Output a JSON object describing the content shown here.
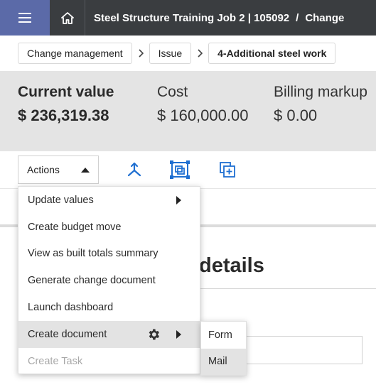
{
  "header": {
    "title_job": "Steel Structure Training Job 2 | 105092",
    "title_sep": "/",
    "title_section": "Change"
  },
  "breadcrumb": {
    "items": [
      {
        "label": "Change management"
      },
      {
        "label": "Issue"
      },
      {
        "label": "4-Additional steel work"
      }
    ]
  },
  "summary": {
    "current_label": "Current value",
    "current_value": "$ 236,319.38",
    "cost_label": "Cost",
    "cost_value": "$ 160,000.00",
    "billing_label": "Billing markup",
    "billing_value": "$ 0.00"
  },
  "toolbar": {
    "actions_label": "Actions"
  },
  "actions_menu": {
    "items": [
      {
        "label": "Update values"
      },
      {
        "label": "Create budget move"
      },
      {
        "label": "View as built totals summary"
      },
      {
        "label": "Generate change document"
      },
      {
        "label": "Launch dashboard"
      },
      {
        "label": "Create document"
      },
      {
        "label": "Create Task"
      }
    ]
  },
  "submenu": {
    "items": [
      {
        "label": "Form"
      },
      {
        "label": "Mail"
      }
    ]
  },
  "main": {
    "heading_fragment": "details"
  },
  "colors": {
    "topbar": "#3a3d40",
    "menu_button": "#5b6aa8",
    "summary_bg": "#e4e4e4",
    "icon_blue": "#1f6fd1"
  }
}
